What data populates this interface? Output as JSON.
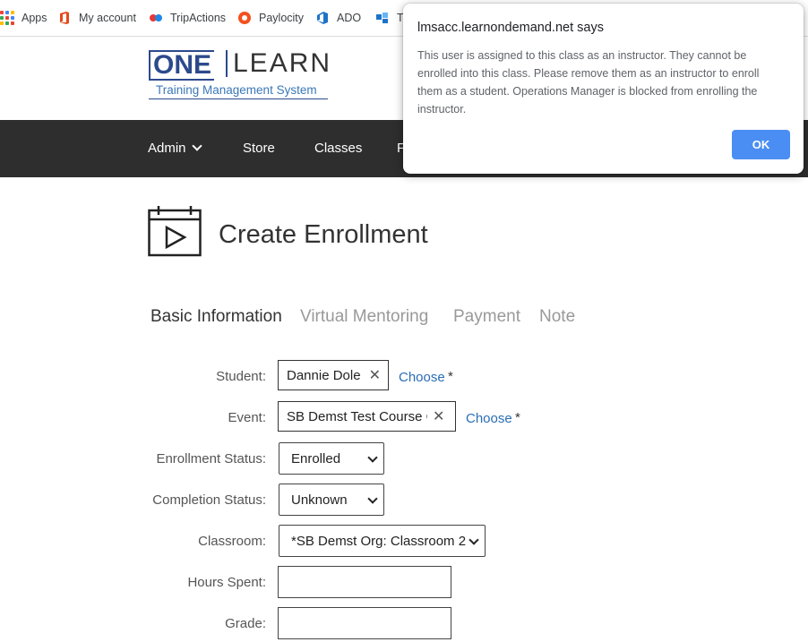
{
  "bookmarks": [
    {
      "label": "Apps",
      "icon": "apps-grid-icon"
    },
    {
      "label": "My account",
      "icon": "office-icon"
    },
    {
      "label": "TripActions",
      "icon": "tripactions-icon"
    },
    {
      "label": "Paylocity",
      "icon": "paylocity-icon"
    },
    {
      "label": "ADO",
      "icon": "ado-icon"
    },
    {
      "label": "T",
      "icon": "tile-icon"
    }
  ],
  "logo": {
    "one": "ONE",
    "learn": "LEARN",
    "subtitle": "Training Management System"
  },
  "nav": {
    "admin": "Admin",
    "store": "Store",
    "classes": "Classes",
    "partial": "F"
  },
  "page": {
    "title": "Create Enrollment"
  },
  "tabs": [
    "Basic Information",
    "Virtual Mentoring",
    "Payment",
    "Note"
  ],
  "form": {
    "student": {
      "label": "Student:",
      "value": "Dannie Dole",
      "choose": "Choose",
      "required": "*"
    },
    "event": {
      "label": "Event:",
      "value": "SB Demst Test Course C",
      "choose": "Choose",
      "required": "*"
    },
    "enrollment_status": {
      "label": "Enrollment Status:",
      "value": "Enrolled"
    },
    "completion_status": {
      "label": "Completion Status:",
      "value": "Unknown"
    },
    "classroom": {
      "label": "Classroom:",
      "value": "*SB Demst Org: Classroom 2"
    },
    "hours_spent": {
      "label": "Hours Spent:",
      "value": ""
    },
    "grade": {
      "label": "Grade:",
      "value": ""
    }
  },
  "dialog": {
    "title": "lmsacc.learnondemand.net says",
    "message": "This user is assigned to this class as an instructor. They cannot be enrolled into this class. Please remove them as an instructor to enroll them as a student. Operations Manager is blocked from enrolling the instructor.",
    "ok": "OK"
  },
  "colors": {
    "nav_bg": "#2e2e2e",
    "link": "#2a6db5",
    "ok_button": "#4a8ef3",
    "logo": "#2c4a8c"
  }
}
